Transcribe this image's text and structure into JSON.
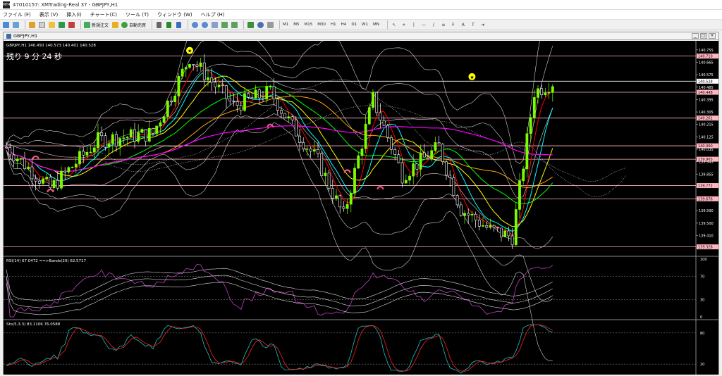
{
  "window": {
    "title": "47010157: XMTrading-Real 37 - GBPJPY,H1",
    "app_icon": "MT4"
  },
  "menu": [
    "ファイル (F)",
    "表示 (V)",
    "挿入(I)",
    "チャート(C)",
    "ツール (T)",
    "ウィンドウ (W)",
    "ヘルプ (H)"
  ],
  "toolbar": {
    "new_order_label": "新規注文",
    "auto_trade_label": "自動売買",
    "timeframes": [
      "M1",
      "M5",
      "M15",
      "M30",
      "H1",
      "H4",
      "D1",
      "W1",
      "MN"
    ],
    "icons": [
      "new-chart-icon",
      "profiles-icon",
      "market-watch-icon",
      "data-window-icon",
      "navigator-icon",
      "terminal-icon",
      "tester-icon"
    ]
  },
  "chart_window": {
    "title": "GBPJPY,H1",
    "controls": [
      "_",
      "□",
      "×"
    ]
  },
  "main_chart": {
    "info": "GBPJPY,H1  140.450 140.573 140.401 140.528",
    "timer": "残り 9 分 24 秒",
    "price_labels": [
      "140.755",
      "140.665",
      "140.575",
      "140.485",
      "140.395",
      "140.305",
      "140.215",
      "140.125",
      "140.035",
      "139.945",
      "139.855",
      "139.765",
      "139.680",
      "139.590",
      "139.500",
      "139.410",
      "139.320"
    ],
    "highlighted_levels": [
      {
        "price": "140.710",
        "color": "#ffb6c1"
      },
      {
        "price": "140.528",
        "color": "#ffffff"
      },
      {
        "price": "140.448",
        "color": "#ffb6c1"
      },
      {
        "price": "140.261",
        "color": "#ffb6c1"
      },
      {
        "price": "140.060",
        "color": "#ffb6c1"
      },
      {
        "price": "139.963",
        "color": "#ffb6c1"
      },
      {
        "price": "139.772",
        "color": "#ffb6c1"
      },
      {
        "price": "139.676",
        "color": "#ffb6c1"
      },
      {
        "price": "139.328",
        "color": "#ffb6c1"
      }
    ]
  },
  "rsi_panel": {
    "info": "RSI(14) 67.0472  ==>Bands(20) 62.5717",
    "scale": [
      "100",
      "70",
      "30",
      "0"
    ]
  },
  "stoch_panel": {
    "info": "Sto(5,3,3) 83.1106 76.0588",
    "scale": [
      "80",
      "20"
    ]
  },
  "colors": {
    "background": "#000000",
    "bull_candle": "#7cfc00",
    "bear_candle": "#ffffff",
    "ma_red": "#ff0000",
    "ma_cyan": "#00ffff",
    "ma_yellow": "#ffff00",
    "ma_green": "#00ff00",
    "ma_orange": "#ffa500",
    "ma_magenta": "#ff00ff",
    "bands": "#d3d3d3",
    "level_line": "#ffb6c1"
  }
}
